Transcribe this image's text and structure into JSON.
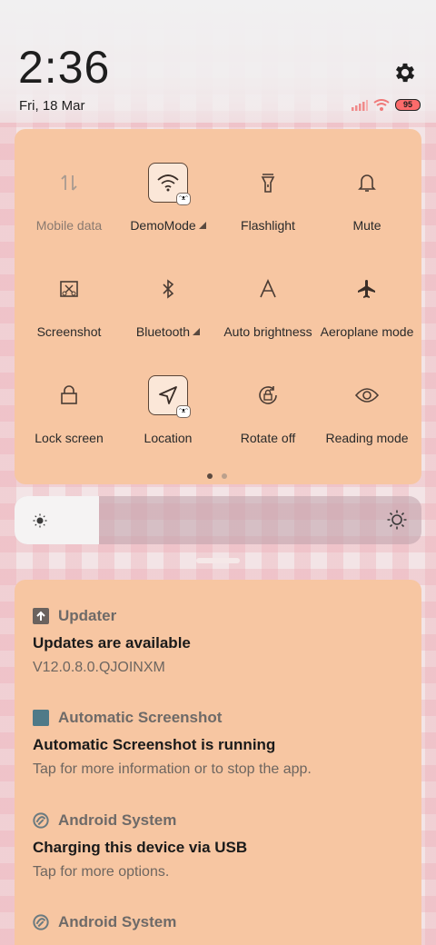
{
  "status": {
    "time": "2:36",
    "date": "Fri, 18 Mar",
    "battery": "95",
    "icons": [
      "settings-icon",
      "signal-icon",
      "wifi-icon",
      "battery-icon"
    ]
  },
  "quick_settings": {
    "tiles": [
      {
        "label": "Mobile data",
        "icon": "mobile-data-icon",
        "active": false
      },
      {
        "label": "DemoMode",
        "icon": "wifi-icon",
        "active": true
      },
      {
        "label": "Flashlight",
        "icon": "flashlight-icon",
        "active": false
      },
      {
        "label": "Mute",
        "icon": "bell-icon",
        "active": false
      },
      {
        "label": "Screenshot",
        "icon": "screenshot-icon",
        "active": false
      },
      {
        "label": "Bluetooth",
        "icon": "bluetooth-icon",
        "active": false
      },
      {
        "label": "Auto brightness",
        "icon": "auto-brightness-icon",
        "active": false
      },
      {
        "label": "Aeroplane mode",
        "icon": "airplane-icon",
        "active": false
      },
      {
        "label": "Lock screen",
        "icon": "lock-icon",
        "active": false
      },
      {
        "label": "Location",
        "icon": "location-icon",
        "active": true
      },
      {
        "label": "Rotate off",
        "icon": "rotate-lock-icon",
        "active": false
      },
      {
        "label": "Reading mode",
        "icon": "eye-icon",
        "active": false
      }
    ],
    "page_count": 2,
    "current_page": 1
  },
  "brightness": {
    "level_fraction": 0.21
  },
  "notifications": [
    {
      "app": "Updater",
      "title": "Updates are available",
      "body": "V12.0.8.0.QJOINXM",
      "icon": "updater-icon"
    },
    {
      "app": "Automatic Screenshot",
      "title": "Automatic Screenshot is running",
      "body": "Tap for more information or to stop the app.",
      "icon": "screenshot-app-icon"
    },
    {
      "app": "Android System",
      "title": "Charging this device via USB",
      "body": "Tap for more options.",
      "icon": "android-system-icon"
    },
    {
      "app": "Android System",
      "title": "",
      "body": "",
      "icon": "android-system-icon"
    }
  ],
  "colors": {
    "panel": "#f7c6a2",
    "accent_dark": "#5a4436"
  }
}
